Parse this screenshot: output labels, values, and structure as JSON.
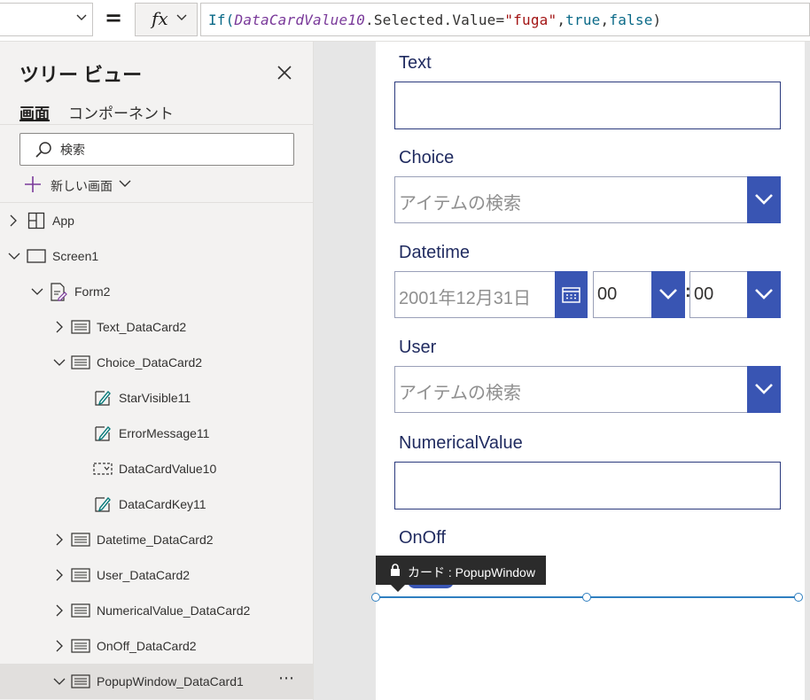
{
  "formula_bar": {
    "equals": "=",
    "fx_label": "fx",
    "formula": {
      "fn": "If(",
      "identifier": "DataCardValue10",
      "member": ".Selected.Value=",
      "string": "\"fuga\"",
      "comma1": ",",
      "true": "true",
      "comma2": ",",
      "false": "false",
      "close": ")"
    }
  },
  "tree_view": {
    "title": "ツリー ビュー",
    "tabs": [
      {
        "label": "画面",
        "active": true
      },
      {
        "label": "コンポーネント",
        "active": false
      }
    ],
    "search": {
      "placeholder": "検索",
      "value": ""
    },
    "new_screen_label": "新しい画面",
    "items": [
      {
        "label": "App",
        "icon": "app-icon"
      },
      {
        "label": "Screen1",
        "icon": "screen-icon"
      },
      {
        "label": "Form2",
        "icon": "form-icon"
      },
      {
        "label": "Text_DataCard2",
        "icon": "datacard-icon"
      },
      {
        "label": "Choice_DataCard2",
        "icon": "datacard-icon"
      },
      {
        "label": "StarVisible11",
        "icon": "label-edit-icon"
      },
      {
        "label": "ErrorMessage11",
        "icon": "label-edit-icon"
      },
      {
        "label": "DataCardValue10",
        "icon": "combobox-icon"
      },
      {
        "label": "DataCardKey11",
        "icon": "label-edit-icon"
      },
      {
        "label": "Datetime_DataCard2",
        "icon": "datacard-icon"
      },
      {
        "label": "User_DataCard2",
        "icon": "datacard-icon"
      },
      {
        "label": "NumericalValue_DataCard2",
        "icon": "datacard-icon"
      },
      {
        "label": "OnOff_DataCard2",
        "icon": "datacard-icon"
      },
      {
        "label": "PopupWindow_DataCard1",
        "icon": "datacard-icon",
        "selected": true,
        "more": "⋯"
      }
    ]
  },
  "form": {
    "text_label": "Text",
    "choice_label": "Choice",
    "choice_placeholder": "アイテムの検索",
    "datetime_label": "Datetime",
    "date_value": "2001年12月31日",
    "hour_value": "00",
    "time_separator": ":",
    "minute_value": "00",
    "user_label": "User",
    "user_placeholder": "アイテムの検索",
    "numerical_label": "NumericalValue",
    "onoff_label": "OnOff",
    "tooltip": "カード : PopupWindow"
  },
  "colors": {
    "accent_blue": "#3955b3",
    "selection": "#2f7fc0",
    "panel_bg": "#f3f2f1"
  }
}
